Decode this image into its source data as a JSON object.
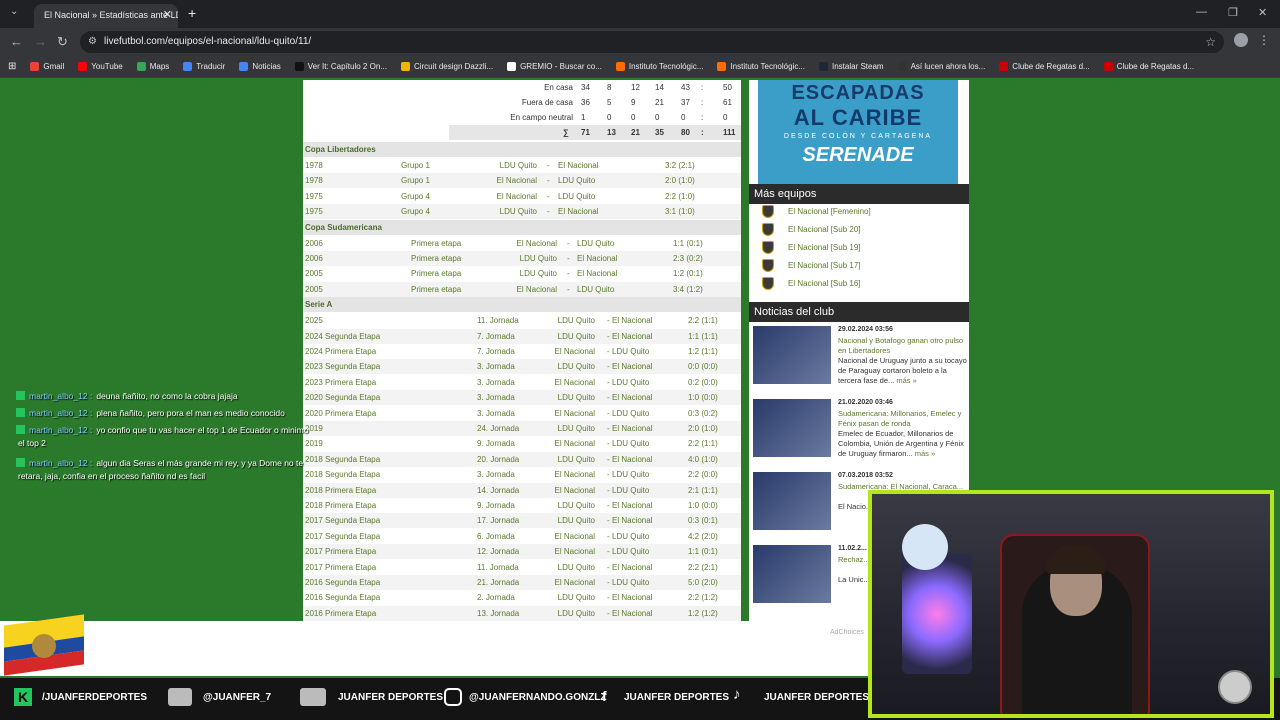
{
  "browser": {
    "tab_title": "El Nacional » Estadísticas ante LDU",
    "url": "livefutbol.com/equipos/el-nacional/ldu-quito/11/",
    "bookmarks": [
      {
        "label": "Gmail",
        "color": "#ea4335"
      },
      {
        "label": "YouTube",
        "color": "#ff0000"
      },
      {
        "label": "Maps",
        "color": "#34a853"
      },
      {
        "label": "Traducir",
        "color": "#4285f4"
      },
      {
        "label": "Noticias",
        "color": "#4285f4"
      },
      {
        "label": "Ver It: Capítulo 2 On...",
        "color": "#111111"
      },
      {
        "label": "Circuit design Dazzli...",
        "color": "#f4b400"
      },
      {
        "label": "GREMIO - Buscar co...",
        "color": "#ffffff"
      },
      {
        "label": "Instituto Tecnológic...",
        "color": "#ff6d00"
      },
      {
        "label": "Instituto Tecnológic...",
        "color": "#ff6d00"
      },
      {
        "label": "Instalar Steam",
        "color": "#1b2838"
      },
      {
        "label": "Así lucen ahora los...",
        "color": "#333333"
      },
      {
        "label": "Clube de Regatas d...",
        "color": "#cc0000"
      },
      {
        "label": "Clube de Regatas d...",
        "color": "#cc0000"
      }
    ]
  },
  "stats_top": [
    {
      "label": "En casa",
      "vals": [
        "34",
        "8",
        "12",
        "14",
        "43",
        ":",
        "50"
      ]
    },
    {
      "label": "Fuera de casa",
      "vals": [
        "36",
        "5",
        "9",
        "21",
        "37",
        ":",
        "61"
      ]
    },
    {
      "label": "En campo neutral",
      "vals": [
        "1",
        "0",
        "0",
        "0",
        "0",
        ":",
        "0"
      ]
    }
  ],
  "stats_sum": {
    "symbol": "∑",
    "vals": [
      "71",
      "13",
      "21",
      "35",
      "80",
      ":",
      "111"
    ]
  },
  "sections": {
    "libertadores": {
      "title": "Copa Libertadores",
      "rows": [
        {
          "year": "1978",
          "round": "Grupo 1",
          "home": "LDU Quito",
          "sep": "-",
          "away": "El Nacional",
          "score": "3:2 (2:1)"
        },
        {
          "year": "1978",
          "round": "Grupo 1",
          "home": "El Nacional",
          "sep": "-",
          "away": "LDU Quito",
          "score": "2:0 (1:0)"
        },
        {
          "year": "1975",
          "round": "Grupo 4",
          "home": "El Nacional",
          "sep": "-",
          "away": "LDU Quito",
          "score": "2:2 (1:0)"
        },
        {
          "year": "1975",
          "round": "Grupo 4",
          "home": "LDU Quito",
          "sep": "-",
          "away": "El Nacional",
          "score": "3:1 (1:0)"
        }
      ]
    },
    "sudamericana": {
      "title": "Copa Sudamericana",
      "rows": [
        {
          "year": "2006",
          "round": "Primera etapa",
          "home": "El Nacional",
          "sep": "-",
          "away": "LDU Quito",
          "score": "1:1 (0:1)"
        },
        {
          "year": "2006",
          "round": "Primera etapa",
          "home": "LDU Quito",
          "sep": "-",
          "away": "El Nacional",
          "score": "2:3 (0:2)"
        },
        {
          "year": "2005",
          "round": "Primera etapa",
          "home": "LDU Quito",
          "sep": "-",
          "away": "El Nacional",
          "score": "1:2 (0:1)"
        },
        {
          "year": "2005",
          "round": "Primera etapa",
          "home": "El Nacional",
          "sep": "-",
          "away": "LDU Quito",
          "score": "3:4 (1:2)"
        }
      ]
    },
    "seriea": {
      "title": "Serie A",
      "rows": [
        {
          "year": "2025",
          "round": "11. Jornada",
          "home": "LDU Quito",
          "sep": "-",
          "away": "El Nacional",
          "score": "2:2 (1:1)"
        },
        {
          "year": "2024 Segunda Etapa",
          "round": "7. Jornada",
          "home": "LDU Quito",
          "sep": "-",
          "away": "El Nacional",
          "score": "1:1 (1:1)"
        },
        {
          "year": "2024 Primera Etapa",
          "round": "7. Jornada",
          "home": "El Nacional",
          "sep": "-",
          "away": "LDU Quito",
          "score": "1:2 (1:1)"
        },
        {
          "year": "2023 Segunda Etapa",
          "round": "3. Jornada",
          "home": "LDU Quito",
          "sep": "-",
          "away": "El Nacional",
          "score": "0:0 (0:0)"
        },
        {
          "year": "2023 Primera Etapa",
          "round": "3. Jornada",
          "home": "El Nacional",
          "sep": "-",
          "away": "LDU Quito",
          "score": "0:2 (0:0)"
        },
        {
          "year": "2020 Segunda Etapa",
          "round": "3. Jornada",
          "home": "LDU Quito",
          "sep": "-",
          "away": "El Nacional",
          "score": "1:0 (0:0)"
        },
        {
          "year": "2020 Primera Etapa",
          "round": "3. Jornada",
          "home": "El Nacional",
          "sep": "-",
          "away": "LDU Quito",
          "score": "0:3 (0:2)"
        },
        {
          "year": "2019",
          "round": "24. Jornada",
          "home": "LDU Quito",
          "sep": "-",
          "away": "El Nacional",
          "score": "2:0 (1:0)"
        },
        {
          "year": "2019",
          "round": "9. Jornada",
          "home": "El Nacional",
          "sep": "-",
          "away": "LDU Quito",
          "score": "2:2 (1:1)"
        },
        {
          "year": "2018 Segunda Etapa",
          "round": "20. Jornada",
          "home": "LDU Quito",
          "sep": "-",
          "away": "El Nacional",
          "score": "4:0 (1:0)"
        },
        {
          "year": "2018 Segunda Etapa",
          "round": "3. Jornada",
          "home": "El Nacional",
          "sep": "-",
          "away": "LDU Quito",
          "score": "2:2 (0:0)"
        },
        {
          "year": "2018 Primera Etapa",
          "round": "14. Jornada",
          "home": "El Nacional",
          "sep": "-",
          "away": "LDU Quito",
          "score": "2:1 (1:1)"
        },
        {
          "year": "2018 Primera Etapa",
          "round": "9. Jornada",
          "home": "LDU Quito",
          "sep": "-",
          "away": "El Nacional",
          "score": "1:0 (0:0)"
        },
        {
          "year": "2017 Segunda Etapa",
          "round": "17. Jornada",
          "home": "LDU Quito",
          "sep": "-",
          "away": "El Nacional",
          "score": "0:3 (0:1)"
        },
        {
          "year": "2017 Segunda Etapa",
          "round": "6. Jornada",
          "home": "El Nacional",
          "sep": "-",
          "away": "LDU Quito",
          "score": "4:2 (2:0)"
        },
        {
          "year": "2017 Primera Etapa",
          "round": "12. Jornada",
          "home": "El Nacional",
          "sep": "-",
          "away": "LDU Quito",
          "score": "1:1 (0:1)"
        },
        {
          "year": "2017 Primera Etapa",
          "round": "11. Jornada",
          "home": "LDU Quito",
          "sep": "-",
          "away": "El Nacional",
          "score": "2:2 (2:1)"
        },
        {
          "year": "2016 Segunda Etapa",
          "round": "21. Jornada",
          "home": "El Nacional",
          "sep": "-",
          "away": "LDU Quito",
          "score": "5:0 (2:0)"
        },
        {
          "year": "2016 Segunda Etapa",
          "round": "2. Jornada",
          "home": "LDU Quito",
          "sep": "-",
          "away": "El Nacional",
          "score": "2:2 (1:2)"
        },
        {
          "year": "2016 Primera Etapa",
          "round": "13. Jornada",
          "home": "LDU Quito",
          "sep": "-",
          "away": "El Nacional",
          "score": "1:2 (1:2)"
        }
      ]
    }
  },
  "ad": {
    "line1": "ESCAPADAS",
    "line2": "AL CARIBE",
    "line3": "DESDE COLÓN Y CARTAGENA",
    "line4": "SERENADE"
  },
  "more_teams": {
    "title": "Más equipos",
    "items": [
      "El Nacional [Femenino]",
      "El Nacional [Sub 20]",
      "El Nacional [Sub 19]",
      "El Nacional [Sub 17]",
      "El Nacional [Sub 16]"
    ]
  },
  "news": {
    "title": "Noticias del club",
    "items": [
      {
        "date": "29.02.2024 03:56",
        "title": "Nacional y Botafogo ganan otro pulso en Libertadores",
        "teaser": "Nacional de Uruguay junto a su tocayo de Paraguay cortaron boleto a la tercera fase de...",
        "more": "más »"
      },
      {
        "date": "21.02.2020 03:46",
        "title": "Sudamericana: Millonarios, Emelec y Fénix pasan de ronda",
        "teaser": "Emelec de Ecuador, Millonarios de Colombia, Unión de Argentina y Fénix de Uruguay firmaron...",
        "more": "más »"
      },
      {
        "date": "07.03.2018 03:52",
        "title": "Sudamericana: El Nacional, Caraca...",
        "teaser": "El Nacio... y Colón... este ma...",
        "more": ""
      },
      {
        "date": "11.02.2...",
        "title": "Rechaz... Tucuma...",
        "teaser": "La Unic... Conme... una pro...",
        "more": ""
      }
    ]
  },
  "adchoices": "AdChoices",
  "chat": [
    {
      "user": "martin_albo_12 :",
      "msg": "deuna ñañito, no como la cobra jajaja"
    },
    {
      "user": "martin_albo_12 :",
      "msg": "plena ñañito, pero pora el man es medio conocido"
    },
    {
      "user": "martin_albo_12 :",
      "msg": "yo confio que tu vas hacer el top 1 de Ecuador o minimo",
      "cont": "el top 2"
    },
    {
      "user": "martin_albo_12 :",
      "msg": "algun dia Seras el más grande mi rey, y ya Dome no te",
      "cont": "retara, jaja, confia en el proceso ñañito nd es facil"
    }
  ],
  "socials": {
    "kick": "/JUANFERDEPORTES",
    "discord": "@JUANFER_7",
    "brand1": "JUANFER DEPORTES",
    "instagram": "@JUANFERNANDO.GONZLZ",
    "brand2": "JUANFER DEPORTES",
    "brand3": "JUANFER DEPORTES"
  }
}
